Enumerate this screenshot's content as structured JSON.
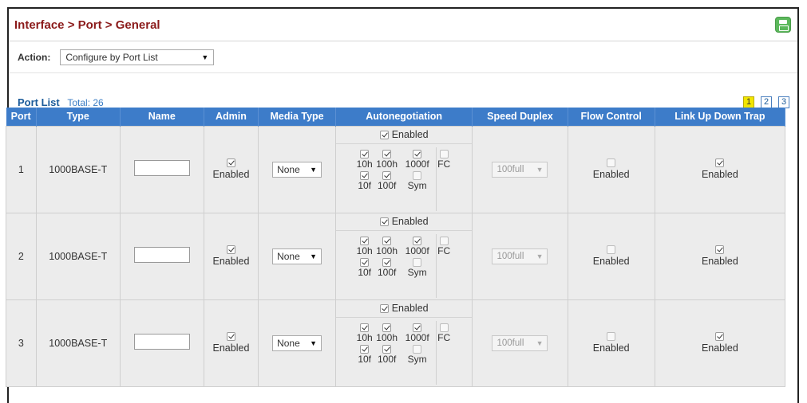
{
  "header": {
    "title": "Interface > Port > General"
  },
  "action": {
    "label": "Action:",
    "selected": "Configure by Port List"
  },
  "port_list": {
    "title": "Port List",
    "total": "Total: 26",
    "pages": [
      "1",
      "2",
      "3"
    ],
    "active_page": "1"
  },
  "table": {
    "headers": [
      "Port",
      "Type",
      "Name",
      "Admin",
      "Media Type",
      "Autonegotiation",
      "Speed Duplex",
      "Flow Control",
      "Link Up Down Trap"
    ],
    "rows": [
      {
        "port": "1",
        "type": "1000BASE-T",
        "name": "",
        "admin_label": "Enabled",
        "admin_checked": true,
        "media": "None",
        "autoneg": {
          "enabled_label": "Enabled",
          "enabled": true,
          "opt_10h": "10h",
          "opt_10f": "10f",
          "opt_100h": "100h",
          "opt_100f": "100f",
          "opt_1000f": "1000f",
          "opt_sym": "Sym",
          "opt_fc": "FC"
        },
        "speed_duplex": "100full",
        "flow_label": "Enabled",
        "flow_checked": false,
        "trap_label": "Enabled",
        "trap_checked": true
      },
      {
        "port": "2",
        "type": "1000BASE-T",
        "name": "",
        "admin_label": "Enabled",
        "admin_checked": true,
        "media": "None",
        "autoneg": {
          "enabled_label": "Enabled",
          "enabled": true,
          "opt_10h": "10h",
          "opt_10f": "10f",
          "opt_100h": "100h",
          "opt_100f": "100f",
          "opt_1000f": "1000f",
          "opt_sym": "Sym",
          "opt_fc": "FC"
        },
        "speed_duplex": "100full",
        "flow_label": "Enabled",
        "flow_checked": false,
        "trap_label": "Enabled",
        "trap_checked": true
      },
      {
        "port": "3",
        "type": "1000BASE-T",
        "name": "",
        "admin_label": "Enabled",
        "admin_checked": true,
        "media": "None",
        "autoneg": {
          "enabled_label": "Enabled",
          "enabled": true,
          "opt_10h": "10h",
          "opt_10f": "10f",
          "opt_100h": "100h",
          "opt_100f": "100f",
          "opt_1000f": "1000f",
          "opt_sym": "Sym",
          "opt_fc": "FC"
        },
        "speed_duplex": "100full",
        "flow_label": "Enabled",
        "flow_checked": false,
        "trap_label": "Enabled",
        "trap_checked": true
      }
    ]
  },
  "colors": {
    "header_bg": "#3d7cc9",
    "title": "#8b1a1a",
    "row_bg": "#ececec",
    "active_page": "#f2e600"
  },
  "icons": {
    "save": "save-icon",
    "dropdown": "dropdown-arrow-icon"
  }
}
